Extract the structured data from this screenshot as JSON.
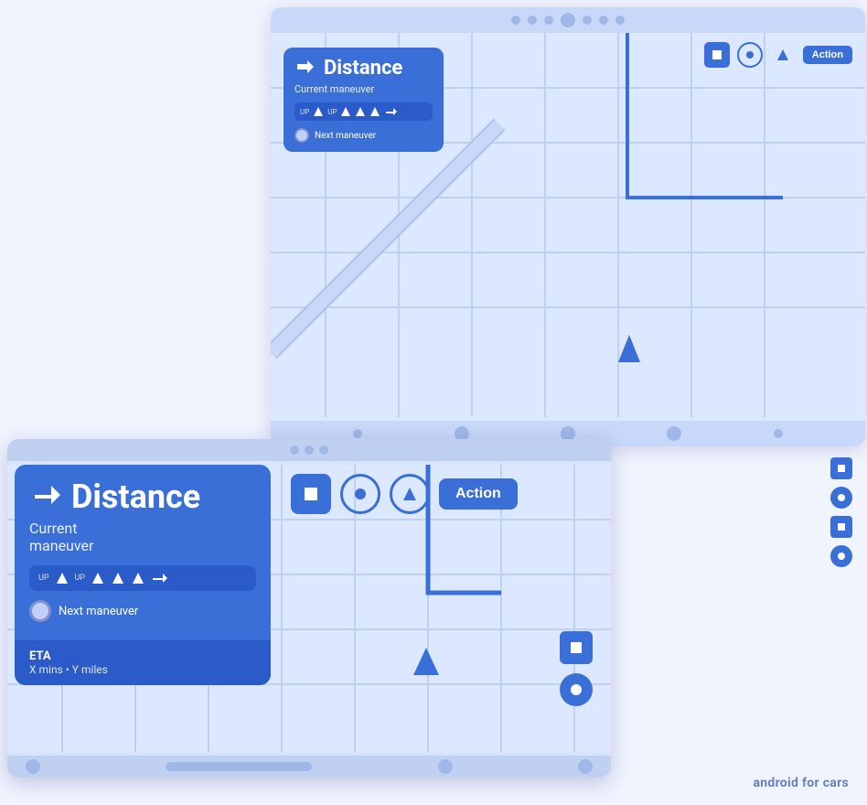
{
  "large_screen": {
    "nav_card": {
      "distance": "Distance",
      "subtitle": "Current maneuver",
      "maneuver_labels": [
        "UP",
        "UP",
        "",
        "",
        ""
      ],
      "next_maneuver_label": "Next maneuver"
    },
    "toolbar": {
      "action_label": "Action"
    }
  },
  "small_screen": {
    "nav_card": {
      "distance": "Distance",
      "subtitle": "Current\nmaneuver",
      "up_labels": [
        "UP",
        "UP"
      ],
      "next_maneuver_label": "Next maneuver",
      "eta_title": "ETA",
      "eta_subtitle": "X mins • Y miles"
    },
    "toolbar": {
      "action_label": "Action"
    }
  },
  "brand": {
    "text1": "android",
    "text2": "for cars"
  }
}
